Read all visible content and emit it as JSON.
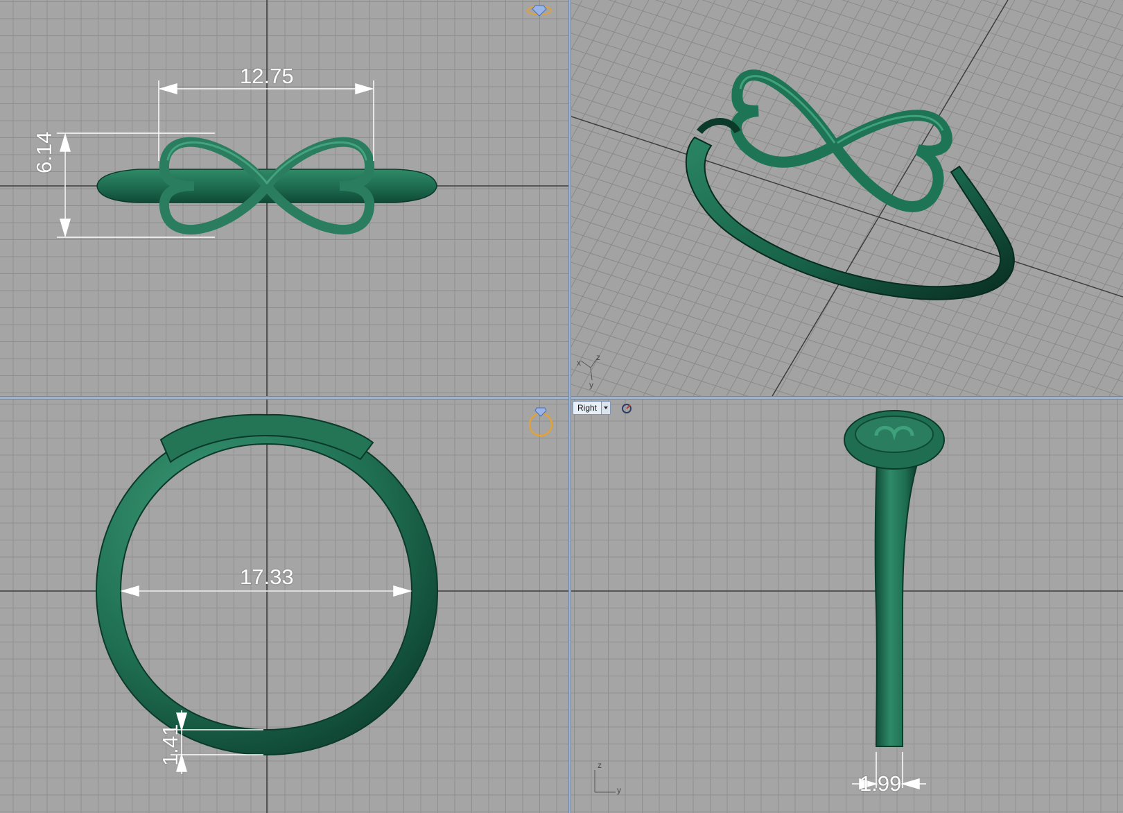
{
  "dimensions": {
    "top_width": "12.75",
    "top_height": "6.14",
    "front_inner_diameter": "17.33",
    "front_shank_thickness": "1.41",
    "right_shank_width": "1.99"
  },
  "viewports": {
    "right": {
      "tab_label": "Right"
    }
  },
  "axes": {
    "persp": {
      "x": "x",
      "y": "y",
      "z": "z"
    },
    "right": {
      "y": "y",
      "z": "z"
    }
  },
  "icons": {
    "top_view_badge": "ring-top-icon",
    "front_view_badge": "ring-front-icon",
    "right_view_tool": "camera-rotate-icon"
  },
  "colors": {
    "ring": "#1f6e52",
    "ring_highlight": "#3fa07c",
    "ring_shadow": "#0b3a2a",
    "grid_bg": "#a5a5a5",
    "grid_line": "#8e8e8e",
    "axis_line": "#3a3a3a",
    "dimension": "#ffffff",
    "badge": "#e0a23a"
  }
}
